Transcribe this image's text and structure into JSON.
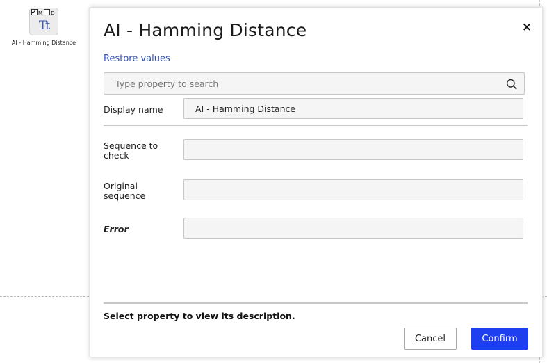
{
  "canvas": {
    "node": {
      "flag_m": "M",
      "flag_d": "D",
      "glyph": "Tt",
      "label": "AI - Hamming Distance",
      "icon": "text-type-icon"
    }
  },
  "dialog": {
    "title": "AI - Hamming Distance",
    "close_label": "×",
    "restore_label": "Restore values",
    "search": {
      "placeholder": "Type property to search",
      "value": "",
      "icon": "search-icon"
    },
    "properties": [
      {
        "label": "Display name",
        "value": "AI - Hamming Distance"
      },
      {
        "label": "Sequence to check",
        "value": ""
      },
      {
        "label": "Original sequence",
        "value": ""
      },
      {
        "label": "Error",
        "value": ""
      }
    ],
    "description": "Select property to view its description.",
    "cancel_label": "Cancel",
    "confirm_label": "Confirm"
  },
  "colors": {
    "accent": "#1d3ff0",
    "link": "#2f4fb8",
    "field_bg": "#f5f5f5"
  }
}
